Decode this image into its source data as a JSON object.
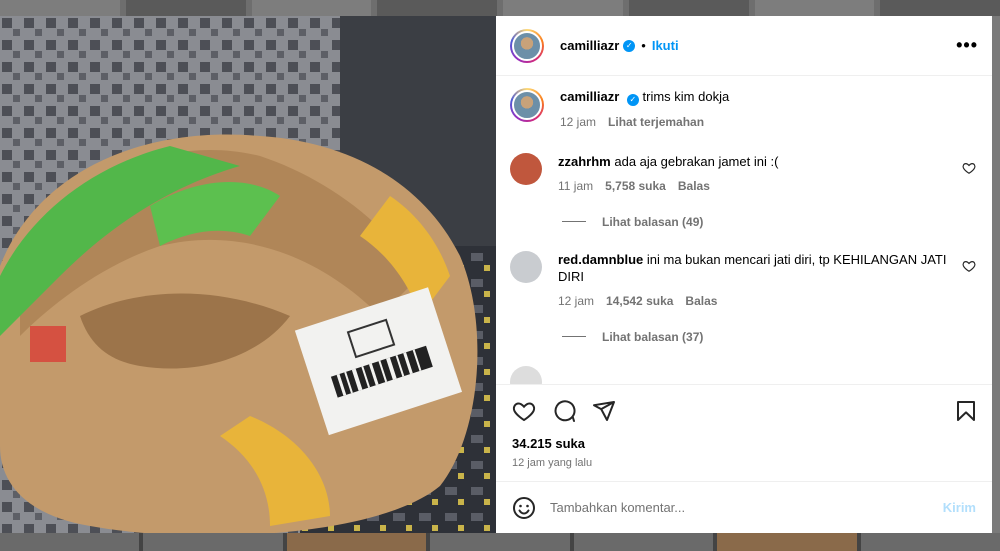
{
  "post": {
    "username": "camilliazr",
    "follow_label": "Ikuti",
    "separator": "•",
    "more_label": "•••",
    "verified_mark": "✓"
  },
  "caption": {
    "username": "camilliazr",
    "text": "trims kim dokja",
    "time": "12 jam",
    "translate_label": "Lihat terjemahan"
  },
  "comments": [
    {
      "username": "zzahrhm",
      "text": "ada aja gebrakan jamet ini :(",
      "time": "11 jam",
      "likes": "5,758 suka",
      "reply_label": "Balas",
      "view_replies": "Lihat balasan (49)",
      "avatar_color": "#c0573d"
    },
    {
      "username": "red.damnblue",
      "text": "ini ma bukan mencari jati diri, tp KEHILANGAN JATI DIRI",
      "time": "12 jam",
      "likes": "14,542 suka",
      "reply_label": "Balas",
      "view_replies": "Lihat balasan (37)",
      "avatar_color": "#c9ccd0"
    }
  ],
  "stats": {
    "likes": "34.215 suka",
    "posted": "12 jam yang lalu"
  },
  "composer": {
    "placeholder": "Tambahkan komentar...",
    "post_label": "Kirim"
  },
  "icons": {
    "like": "heart-icon",
    "comment": "comment-icon",
    "share": "paper-plane-icon",
    "save": "bookmark-icon",
    "emoji": "emoji-icon",
    "more": "more-options-icon"
  },
  "colors": {
    "accent": "#0095f6",
    "muted": "#737373",
    "post_disabled": "#b2dffc"
  }
}
